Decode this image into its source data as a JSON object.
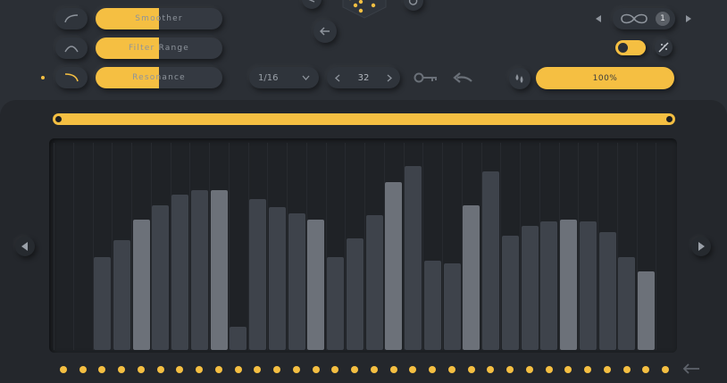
{
  "colors": {
    "accent": "#f5bf42",
    "bar_dark": "#3e434b",
    "bar_light": "#6c7179",
    "bg": "#2b2f35",
    "panel": "#24272c"
  },
  "sliders": [
    {
      "label": "Smoother",
      "value": 0.5,
      "curve_icon": "curve-ease-out-icon",
      "active": false
    },
    {
      "label": "Filter Range",
      "value": 0.5,
      "curve_icon": "curve-arch-icon",
      "active": false
    },
    {
      "label": "Resonance",
      "value": 0.5,
      "curve_icon": "curve-ease-in-icon",
      "active": true
    }
  ],
  "step_division": {
    "value": "1/16",
    "icon": "chevron-down-icon"
  },
  "step_count": {
    "value": "32",
    "prev_icon": "chevron-left-icon",
    "next_icon": "chevron-right-icon"
  },
  "key_icon": "key-icon",
  "return_icon": "return-arrow-icon",
  "mix": {
    "icon": "drops-icon",
    "value": "100%"
  },
  "loop": {
    "icon": "infinity-loop-icon",
    "count": "1",
    "prev_icon": "triangle-left-icon",
    "next_icon": "triangle-right-icon"
  },
  "toggle": {
    "on": true,
    "icon": "magic-wand-icon"
  },
  "top_controls": {
    "dice_icon": "dice-icon",
    "back_icon": "arrow-left-icon",
    "share_icon": "share-icon",
    "undo_icon": "undo-icon"
  },
  "range_bar": {
    "start": 0.0,
    "end": 1.0
  },
  "nav": {
    "left_icon": "play-left-icon",
    "right_icon": "play-right-icon",
    "back_icon": "arrow-back-icon"
  },
  "sequence": {
    "step_count": 32,
    "values": [
      0,
      0,
      0.45,
      0.53,
      0.63,
      0.7,
      0.75,
      0.77,
      0.77,
      0.11,
      0.73,
      0.69,
      0.66,
      0.63,
      0.45,
      0.54,
      0.65,
      0.81,
      0.89,
      0.43,
      0.42,
      0.7,
      0.86,
      0.55,
      0.6,
      0.62,
      0.63,
      0.62,
      0.57,
      0.45,
      0.38,
      0
    ],
    "highlighted": [
      4,
      8,
      13,
      17,
      21,
      26,
      30
    ]
  }
}
